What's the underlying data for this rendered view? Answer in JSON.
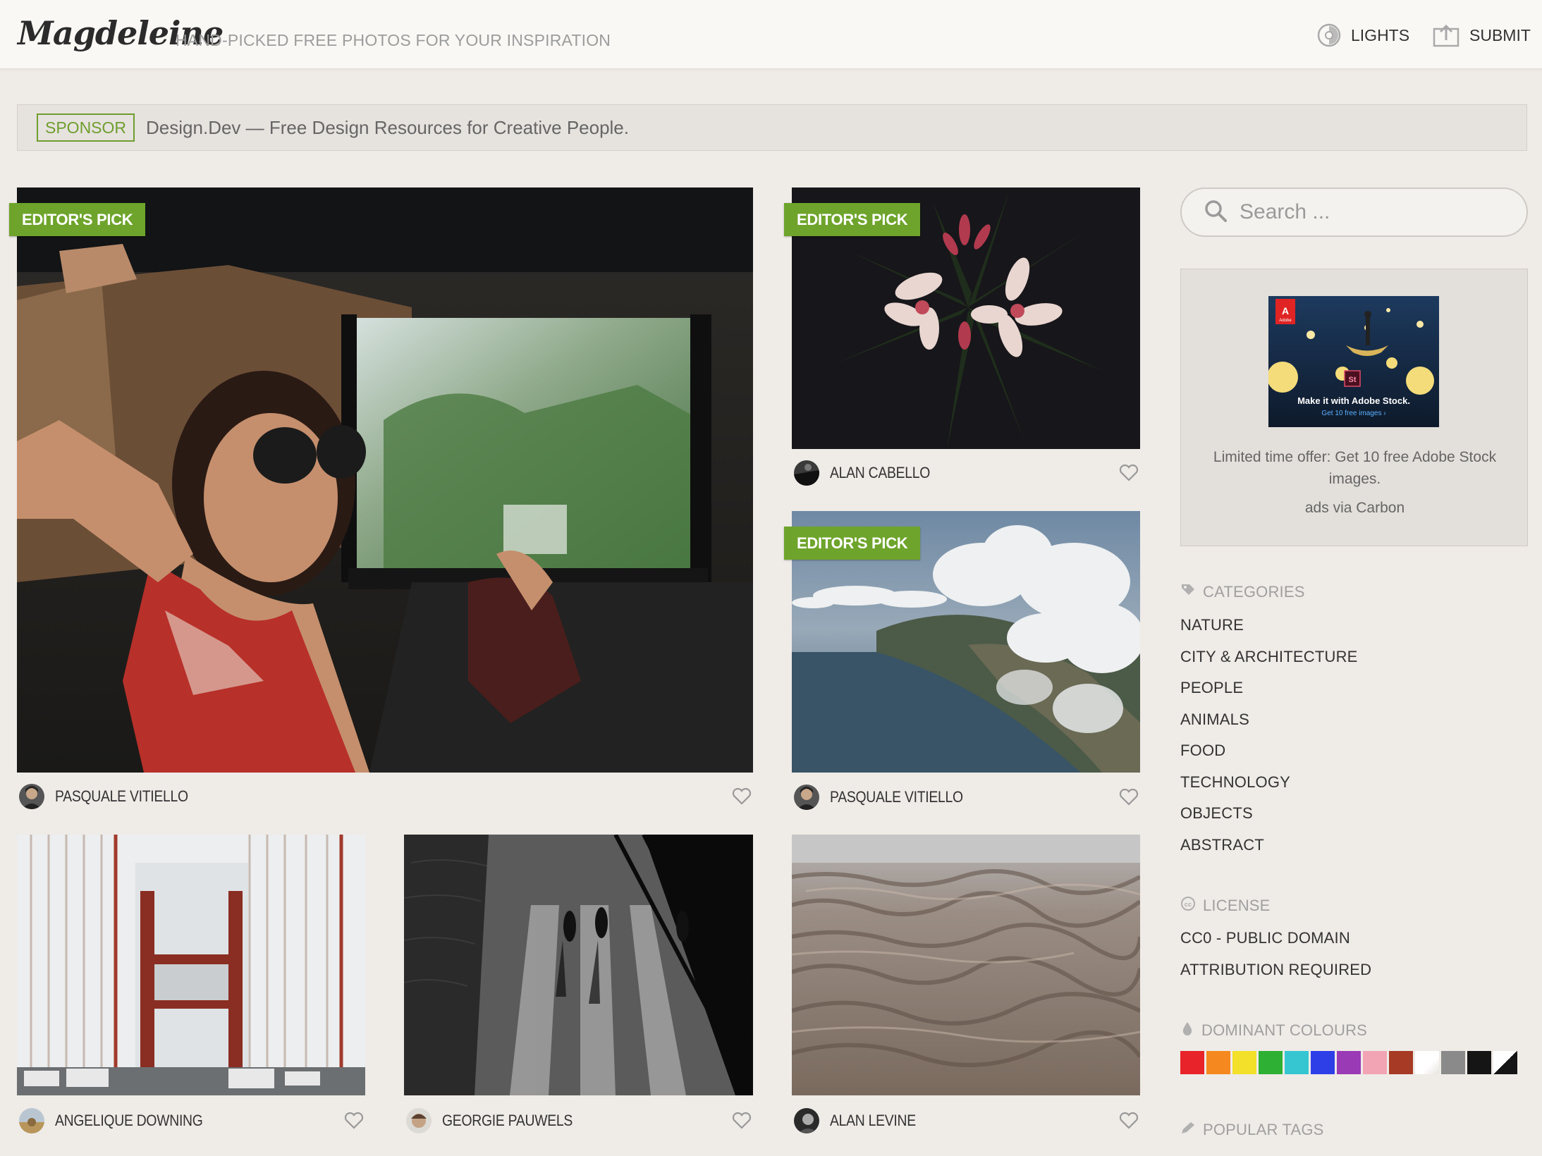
{
  "header": {
    "logo": "Magdeleine",
    "tagline": "HAND-PICKED FREE PHOTOS FOR YOUR INSPIRATION",
    "lights_label": "LIGHTS",
    "submit_label": "SUBMIT"
  },
  "sponsor": {
    "badge": "SPONSOR",
    "text": "Design.Dev — Free Design Resources for Creative People."
  },
  "photos": [
    {
      "author": "PASQUALE VITIELLO",
      "editors_pick": "EDITOR'S PICK"
    },
    {
      "author": "ALAN CABELLO",
      "editors_pick": "EDITOR'S PICK"
    },
    {
      "author": "PASQUALE VITIELLO",
      "editors_pick": "EDITOR'S PICK"
    },
    {
      "author": "ANGELIQUE DOWNING"
    },
    {
      "author": "GEORGIE PAUWELS"
    },
    {
      "author": "ALAN LEVINE"
    }
  ],
  "search": {
    "placeholder": "Search ..."
  },
  "ad": {
    "image_headline": "Make it with Adobe Stock.",
    "image_subline": "Get 10 free images ›",
    "text": "Limited time offer: Get 10 free Adobe Stock images.",
    "via": "ads via Carbon"
  },
  "categories": {
    "title": "CATEGORIES",
    "items": [
      "NATURE",
      "CITY & ARCHITECTURE",
      "PEOPLE",
      "ANIMALS",
      "FOOD",
      "TECHNOLOGY",
      "OBJECTS",
      "ABSTRACT"
    ]
  },
  "license": {
    "title": "LICENSE",
    "items": [
      "CC0 - PUBLIC DOMAIN",
      "ATTRIBUTION REQUIRED"
    ]
  },
  "dominant_colours": {
    "title": "DOMINANT COLOURS",
    "colors": [
      "#e8232a",
      "#f5891f",
      "#f2e02a",
      "#2eb034",
      "#35c6d2",
      "#2f3fe8",
      "#9a3ab5",
      "#f2a4b4",
      "#a63a25",
      "#ffffff",
      "#8a8a8a",
      "#151515",
      "split"
    ]
  },
  "popular_tags": {
    "title": "POPULAR TAGS"
  },
  "colors": {
    "accent": "#6ea42b",
    "background": "#efebe7"
  }
}
